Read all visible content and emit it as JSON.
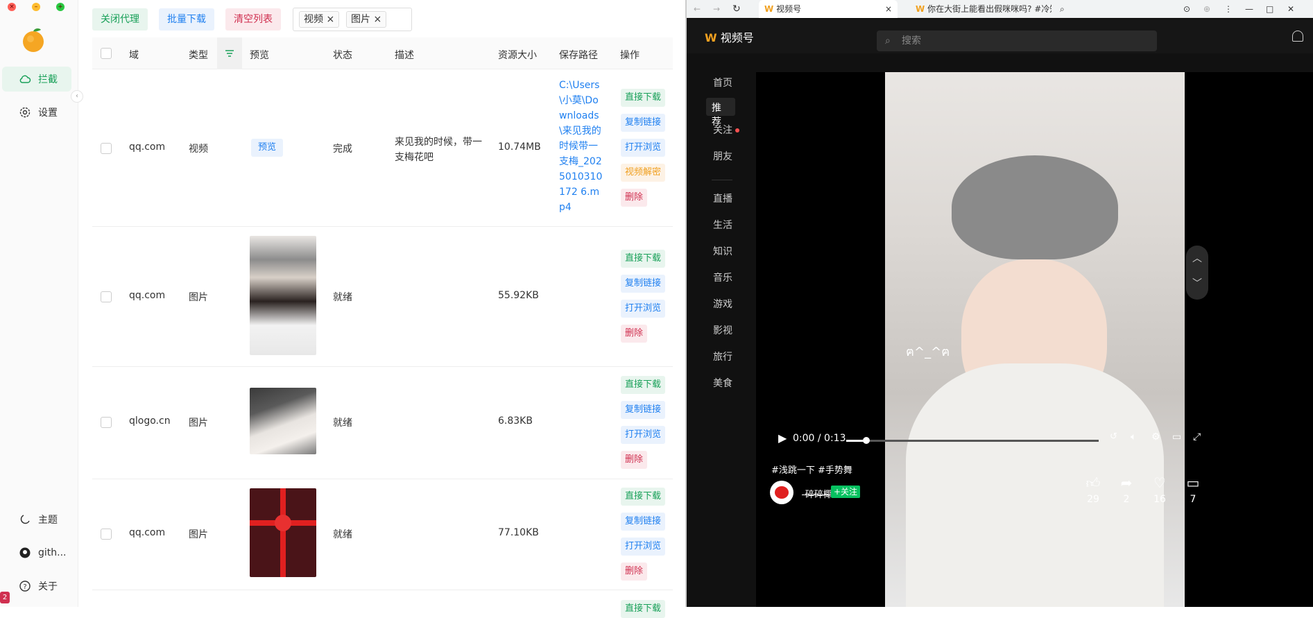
{
  "sidebar": {
    "items": [
      {
        "label": "拦截"
      },
      {
        "label": "设置"
      }
    ],
    "bottom": [
      {
        "label": "主题"
      },
      {
        "label": "gith..."
      },
      {
        "label": "关于"
      }
    ],
    "badge": "2"
  },
  "toolbar": {
    "close_proxy": "关闭代理",
    "batch_download": "批量下载",
    "clear_list": "清空列表",
    "filter_tags": [
      "视频",
      "图片"
    ]
  },
  "table": {
    "headers": [
      "域",
      "类型",
      "预览",
      "状态",
      "描述",
      "资源大小",
      "保存路径",
      "操作"
    ],
    "preview_btn": "预览",
    "rows": [
      {
        "domain": "qq.com",
        "type": "视频",
        "status": "完成",
        "desc": "来见我的时候，带一支梅花吧",
        "size": "10.74MB",
        "path": "C:\\Users\\小莫\\Downloads\\来见我的时候带一支梅_2025010310172 6.mp4",
        "actions": [
          "直接下载",
          "复制链接",
          "打开浏览",
          "视频解密",
          "删除"
        ]
      },
      {
        "domain": "qq.com",
        "type": "图片",
        "status": "就绪",
        "desc": "",
        "size": "55.92KB",
        "path": "",
        "actions": [
          "直接下载",
          "复制链接",
          "打开浏览",
          "删除"
        ]
      },
      {
        "domain": "qlogo.cn",
        "type": "图片",
        "status": "就绪",
        "desc": "",
        "size": "6.83KB",
        "path": "",
        "actions": [
          "直接下载",
          "复制链接",
          "打开浏览",
          "删除"
        ]
      },
      {
        "domain": "qq.com",
        "type": "图片",
        "status": "就绪",
        "desc": "",
        "size": "77.10KB",
        "path": "",
        "actions": [
          "直接下载",
          "复制链接",
          "打开浏览",
          "删除"
        ]
      }
    ],
    "partial_action": "直接下载"
  },
  "browser": {
    "tabs": [
      {
        "title": "视频号"
      },
      {
        "title": "你在大街上能看出假咪咪吗? #冷知"
      }
    ],
    "site_name": "视频号",
    "search_placeholder": "搜索",
    "nav": [
      "首页",
      "推荐",
      "关注",
      "朋友",
      "直播",
      "生活",
      "知识",
      "音乐",
      "游戏",
      "影视",
      "旅行",
      "美食"
    ],
    "active_nav": "推荐",
    "video": {
      "time": "0:00 / 0:13",
      "progress": 0.08,
      "overlay_text": "ฅ^_^ฅ",
      "hashtags": "#浅跳一下 #手势舞",
      "author": "-碎碎椰",
      "follow": "+关注",
      "stats": {
        "likes": "29",
        "shares": "2",
        "favorites": "16",
        "comments": "7"
      }
    }
  },
  "colors": {
    "green": "#18a058",
    "blue": "#2080f0",
    "orange": "#f0a020",
    "red": "#d03050"
  }
}
